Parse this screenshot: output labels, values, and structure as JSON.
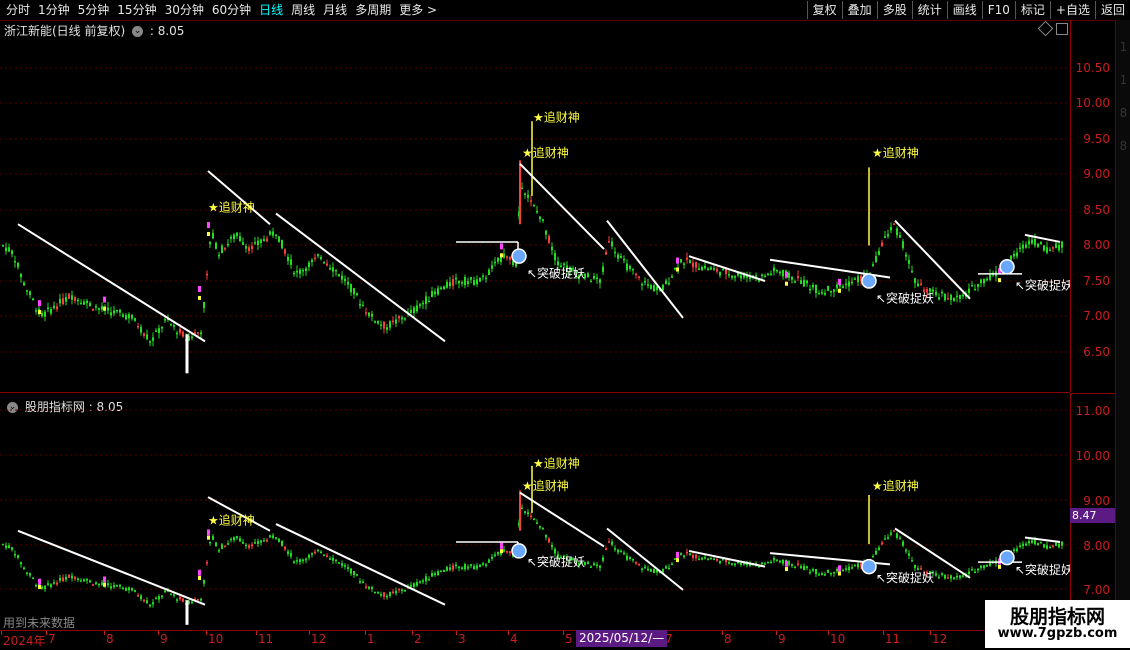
{
  "toolbar": {
    "periods": [
      "分时",
      "1分钟",
      "5分钟",
      "15分钟",
      "30分钟",
      "60分钟",
      "日线",
      "周线",
      "月线",
      "多周期",
      "更多 >"
    ],
    "active_period": "日线",
    "actions": [
      "复权",
      "叠加",
      "多股",
      "统计",
      "画线",
      "F10",
      "标记",
      "+自选",
      "返回"
    ]
  },
  "upper_panel": {
    "title": "浙江新能(日线 前复权)",
    "value_sep": ":",
    "value": "8.05",
    "axis_ticks": [
      "10.50",
      "10.00",
      "9.50",
      "9.00",
      "8.50",
      "8.00",
      "7.50",
      "7.00",
      "6.50"
    ]
  },
  "lower_panel": {
    "title": "股朋指标网",
    "value_sep": ":",
    "value": "8.05",
    "axis_ticks": [
      "11.00",
      "10.00",
      "9.00",
      "8.00",
      "7.00"
    ],
    "axis_partial": [
      "1",
      "1",
      "8",
      "8"
    ],
    "price_tag": "8.47"
  },
  "annotations": {
    "top_signal": "追财神",
    "breakout_signal": "突破捉妖"
  },
  "date_axis": {
    "labels": [
      "2024年",
      "7",
      "8",
      "9",
      "10",
      "11",
      "12",
      "1",
      "2",
      "3",
      "4",
      "5",
      "7",
      "8",
      "9",
      "10",
      "11",
      "12"
    ],
    "cursor": "2025/05/12/—"
  },
  "future_data_note": "用到未来数据",
  "watermark": {
    "title": "股朋指标网",
    "url": "www.7gpzb.com"
  },
  "colors": {
    "up": "#ff3c3c",
    "down": "#22dd22",
    "trend": "#ffffff",
    "signal": "#ffff44",
    "axis": "#c81e1e"
  },
  "chart_data": {
    "type": "line",
    "title": "浙江新能(日线 前复权)",
    "ylim": [
      6.2,
      10.9
    ],
    "x": [
      "2024-06",
      "2024-07",
      "2024-08",
      "2024-09",
      "2024-10",
      "2024-11",
      "2024-12",
      "2025-01",
      "2025-02",
      "2025-03",
      "2025-04",
      "2025-05",
      "2025-07",
      "2025-08",
      "2025-09",
      "2025-10",
      "2025-11",
      "2025-12"
    ],
    "series": [
      {
        "values": [
          8.0,
          7.3,
          7.05,
          6.8,
          8.2,
          8.15,
          7.7,
          7.0,
          7.05,
          7.9,
          7.65,
          7.55,
          7.75,
          7.6,
          7.5,
          7.65,
          7.3,
          8.05
        ]
      }
    ]
  }
}
